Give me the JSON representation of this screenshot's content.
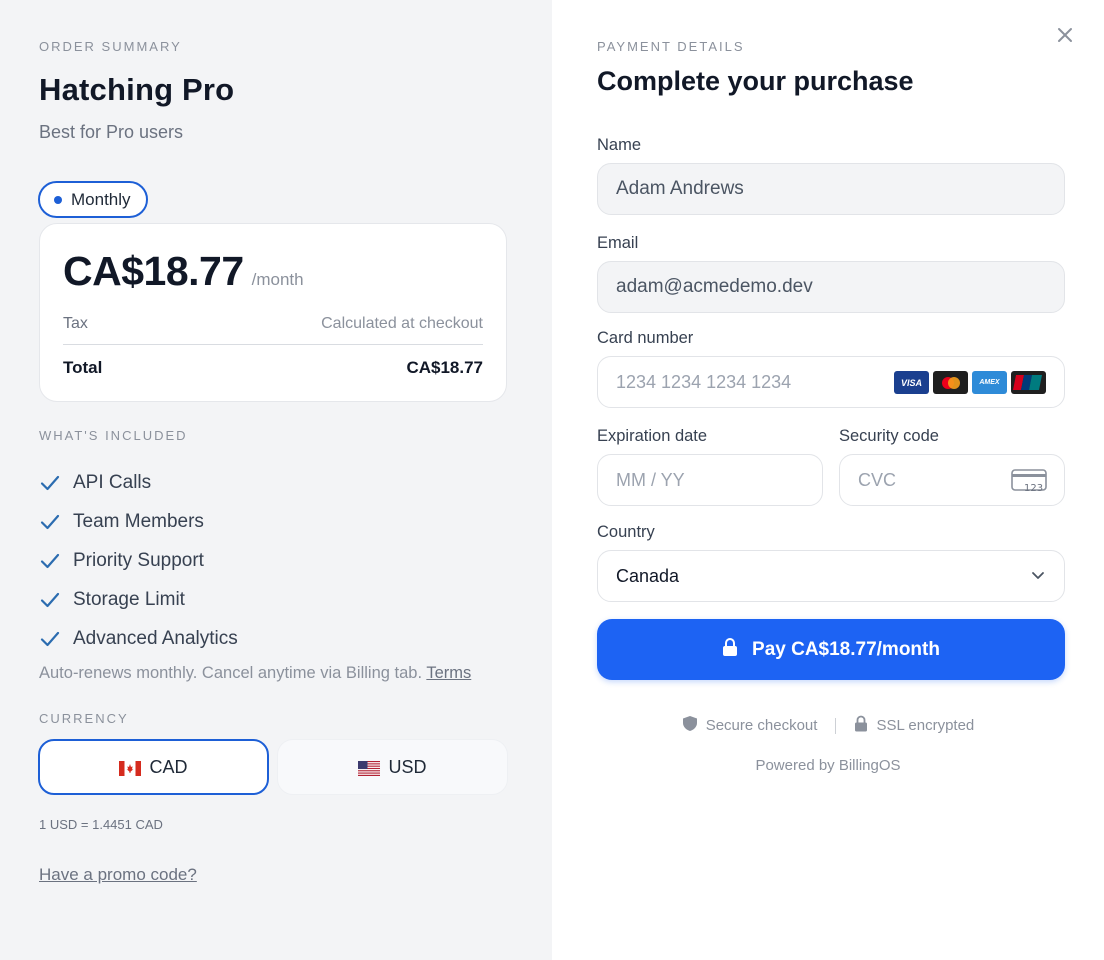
{
  "summary": {
    "eyebrow": "ORDER SUMMARY",
    "plan_name": "Hatching Pro",
    "plan_subtitle": "Best for Pro users",
    "billing_pill": "Monthly",
    "price": "CA$18.77",
    "period": "/month",
    "tax_label": "Tax",
    "tax_value": "Calculated at checkout",
    "total_label": "Total",
    "total_value": "CA$18.77",
    "included_eyebrow": "WHAT'S INCLUDED",
    "features": [
      "API Calls",
      "Team Members",
      "Priority Support",
      "Storage Limit",
      "Advanced Analytics"
    ],
    "renew_text": "Auto-renews monthly. Cancel anytime via Billing tab.",
    "terms_link": "Terms",
    "currency_eyebrow": "CURRENCY",
    "currency_options": [
      "CAD",
      "USD"
    ],
    "currency_selected": "CAD",
    "exchange_rate": "1 USD = 1.4451 CAD",
    "promo_link": "Have a promo code?"
  },
  "payment": {
    "eyebrow": "PAYMENT DETAILS",
    "title": "Complete your purchase",
    "name_label": "Name",
    "name_value": "Adam Andrews",
    "email_label": "Email",
    "email_value": "adam@acmedemo.dev",
    "card_label": "Card number",
    "card_placeholder": "1234 1234 1234 1234",
    "card_brands": [
      "VISA",
      "mastercard",
      "AMEX",
      "UnionPay"
    ],
    "expiry_label": "Expiration date",
    "expiry_placeholder": "MM / YY",
    "cvc_label": "Security code",
    "cvc_placeholder": "CVC",
    "country_label": "Country",
    "country_value": "Canada",
    "pay_button": "Pay CA$18.77/month",
    "secure_text": "Secure checkout",
    "ssl_text": "SSL encrypted",
    "powered_by": "Powered by BillingOS"
  },
  "colors": {
    "accent": "#1d63f3",
    "selected_border": "#1d5fd6",
    "check": "#2b6cb0",
    "left_bg": "#f3f4f6"
  }
}
